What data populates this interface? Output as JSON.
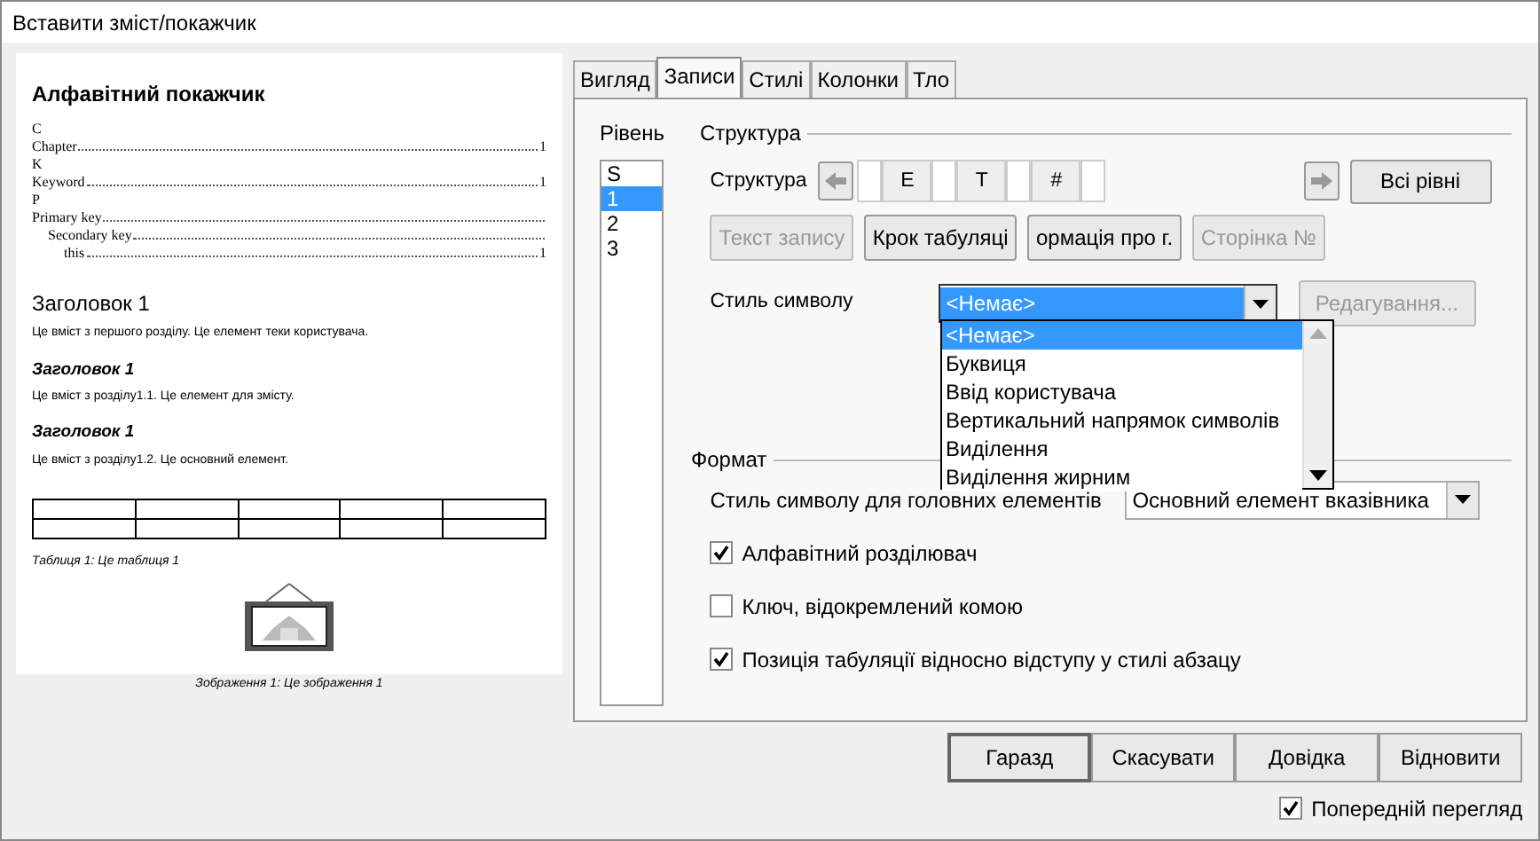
{
  "window": {
    "title": "Вставити зміст/покажчик"
  },
  "preview": {
    "index_title": "Алфавітний покажчик",
    "entries": [
      {
        "kind": "letter",
        "text": "C"
      },
      {
        "kind": "entry",
        "text": "Chapter",
        "page": "1"
      },
      {
        "kind": "letter",
        "text": "K"
      },
      {
        "kind": "entry",
        "text": "Keyword",
        "page": "1"
      },
      {
        "kind": "letter",
        "text": "P"
      },
      {
        "kind": "entry",
        "text": "Primary key",
        "children": [
          {
            "kind": "entry",
            "text": "Secondary key",
            "children": [
              {
                "kind": "entry",
                "text": "this",
                "page": "1"
              }
            ]
          }
        ]
      }
    ],
    "blocks": [
      {
        "kind": "h1",
        "text": "Заголовок 1"
      },
      {
        "kind": "p",
        "text": "Це вміст з першого розділу. Це елемент теки користувача."
      },
      {
        "kind": "h2",
        "text": "Заголовок 1"
      },
      {
        "kind": "p",
        "text": "Це вміст з розділу1.1. Це елемент для змісту."
      },
      {
        "kind": "h2",
        "text": "Заголовок 1"
      },
      {
        "kind": "p",
        "text": "Це вміст з розділу1.2. Це основний елемент."
      }
    ],
    "table_caption": "Таблиця 1: Це таблиця 1",
    "image_caption": "Зображення 1: Це зображення 1"
  },
  "tabs": [
    {
      "label": "Вигляд",
      "selected": false
    },
    {
      "label": "Записи",
      "selected": true
    },
    {
      "label": "Стилі",
      "selected": false
    },
    {
      "label": "Колонки",
      "selected": false
    },
    {
      "label": "Тло",
      "selected": false
    }
  ],
  "level": {
    "label": "Рівень",
    "items": [
      {
        "text": "S",
        "selected": false
      },
      {
        "text": "1",
        "selected": true
      },
      {
        "text": "2",
        "selected": false
      },
      {
        "text": "3",
        "selected": false
      }
    ]
  },
  "structure": {
    "legend": "Структура",
    "label": "Структура",
    "tokens": [
      {
        "kind": "field"
      },
      {
        "kind": "token",
        "text": "E"
      },
      {
        "kind": "field"
      },
      {
        "kind": "token",
        "text": "T"
      },
      {
        "kind": "field"
      },
      {
        "kind": "token",
        "text": "#"
      },
      {
        "kind": "field"
      }
    ],
    "all_levels": "Всі рівні",
    "insert_buttons": [
      {
        "label": "Текст запису",
        "disabled": true
      },
      {
        "label": "Крок табуляці",
        "disabled": false
      },
      {
        "label": "ормація про г.",
        "disabled": false
      },
      {
        "label": "Сторінка №",
        "disabled": true
      }
    ],
    "char_style_label": "Стиль символу",
    "char_style_value": "<Немає>",
    "edit_button": {
      "label": "Редагування...",
      "disabled": true
    },
    "dropdown": [
      {
        "text": "<Немає>",
        "selected": true
      },
      {
        "text": "Буквиця",
        "selected": false
      },
      {
        "text": "Ввід користувача",
        "selected": false
      },
      {
        "text": "Вертикальний напрямок символів",
        "selected": false
      },
      {
        "text": "Виділення",
        "selected": false
      },
      {
        "text": "Виділення жирним",
        "selected": false
      }
    ]
  },
  "format": {
    "legend": "Формат",
    "main_style_label": "Стиль символу для головних елементів",
    "main_style_value": "Основний елемент вказівника",
    "options": [
      {
        "label": "Алфавітний розділювач",
        "checked": true
      },
      {
        "label": "Ключ, відокремлений комою",
        "checked": false
      },
      {
        "label": "Позиція табуляції відносно відступу у стилі абзацу",
        "checked": true
      }
    ]
  },
  "buttons": [
    {
      "label": "Гаразд",
      "default": true
    },
    {
      "label": "Скасувати",
      "default": false
    },
    {
      "label": "Довідка",
      "default": false
    },
    {
      "label": "Відновити",
      "default": false
    }
  ],
  "preview_toggle": {
    "label": "Попередній перегляд",
    "checked": true
  }
}
